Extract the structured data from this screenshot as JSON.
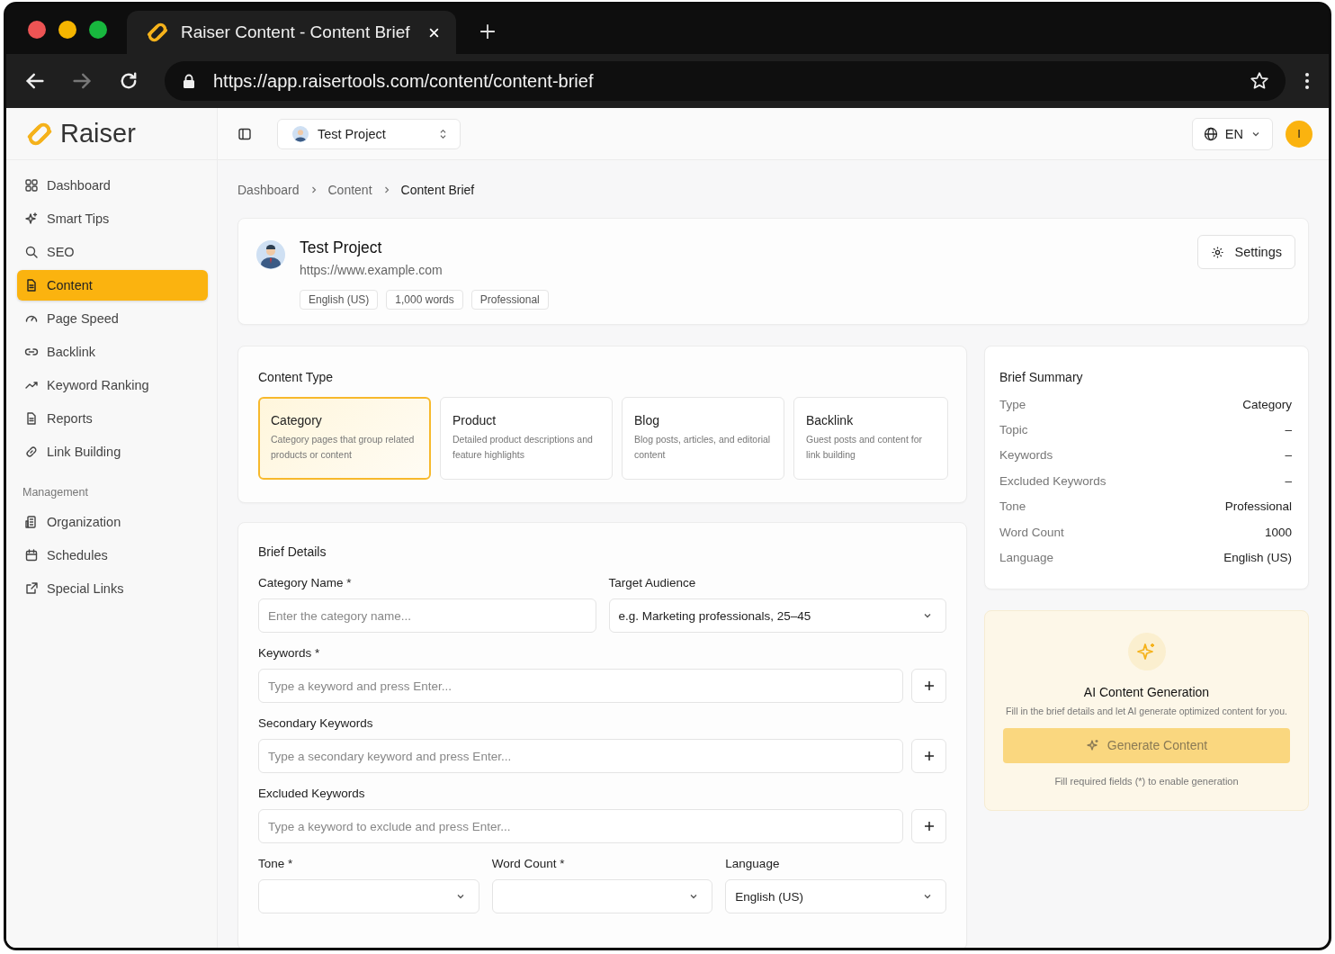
{
  "browser": {
    "tab_title": "Raiser Content - Content Brief",
    "url": "https://app.raisertools.com/content/content-brief"
  },
  "sidebar": {
    "logo": "Raiser",
    "items": [
      {
        "label": "Dashboard",
        "selected": false
      },
      {
        "label": "Smart Tips",
        "selected": false
      },
      {
        "label": "SEO",
        "selected": false
      },
      {
        "label": "Content",
        "selected": true
      },
      {
        "label": "Page Speed",
        "selected": false
      },
      {
        "label": "Backlink",
        "selected": false
      },
      {
        "label": "Keyword Ranking",
        "selected": false
      },
      {
        "label": "Reports",
        "selected": false
      },
      {
        "label": "Link Building",
        "selected": false
      }
    ],
    "section": "Management",
    "management_items": [
      {
        "label": "Organization",
        "selected": false
      },
      {
        "label": "Schedules",
        "selected": false
      },
      {
        "label": "Special Links",
        "selected": false
      }
    ]
  },
  "topbar": {
    "project": "Test Project",
    "language": "EN",
    "avatar": "I"
  },
  "breadcrumb": [
    "Dashboard",
    "Content",
    "Content Brief"
  ],
  "project_card": {
    "name": "Test Project",
    "url": "https://www.example.com",
    "tags": [
      "English (US)",
      "1,000 words",
      "Professional"
    ],
    "settings_button": "Settings"
  },
  "content_type": {
    "title": "Content Type",
    "options": [
      {
        "title": "Category",
        "description": "Category pages that group related products or content",
        "selected": true
      },
      {
        "title": "Product",
        "description": "Detailed product descriptions and feature highlights",
        "selected": false
      },
      {
        "title": "Blog",
        "description": "Blog posts, articles, and editorial content",
        "selected": false
      },
      {
        "title": "Backlink",
        "description": "Guest posts and content for link building",
        "selected": false
      }
    ]
  },
  "brief_details": {
    "title": "Brief Details",
    "first_pair": [
      {
        "kind": "text",
        "label": "Category Name *",
        "placeholder": "Enter the category name..."
      },
      {
        "kind": "select",
        "label": "Target Audience",
        "value": "e.g. Marketing professionals, 25–45"
      }
    ],
    "keyword_fields": [
      {
        "kind": "keyword",
        "label": "Keywords *",
        "placeholder": "Type a keyword and press Enter..."
      },
      {
        "kind": "keyword",
        "label": "Secondary Keywords",
        "placeholder": "Type a secondary keyword and press Enter..."
      },
      {
        "kind": "keyword",
        "label": "Excluded Keywords",
        "placeholder": "Type a keyword to exclude and press Enter..."
      }
    ],
    "settings_fields": [
      {
        "kind": "select",
        "label": "Tone *"
      },
      {
        "kind": "select",
        "label": "Word Count *"
      },
      {
        "kind": "select",
        "label": "Language",
        "value": "English (US)"
      }
    ]
  },
  "summary": {
    "title": "Brief Summary",
    "rows": [
      {
        "label": "Type",
        "value": "Category"
      },
      {
        "label": "Topic",
        "value": "–"
      },
      {
        "label": "Keywords",
        "value": "–"
      },
      {
        "label": "Excluded Keywords",
        "value": "–"
      },
      {
        "label": "Tone",
        "value": "Professional"
      },
      {
        "label": "Word Count",
        "value": "1000"
      },
      {
        "label": "Language",
        "value": "English (US)"
      }
    ]
  },
  "ai_card": {
    "title": "AI Content Generation",
    "description": "Fill in the brief details and let AI generate optimized content for you.",
    "button": "Generate Content",
    "disabled": true,
    "note": "Fill required fields (*) to enable generation"
  }
}
